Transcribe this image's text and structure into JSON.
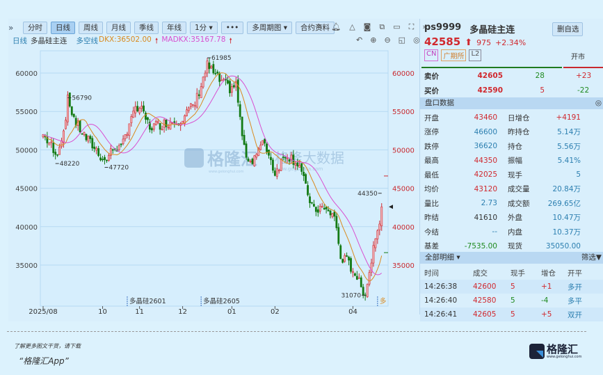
{
  "toolbar": {
    "buttons": [
      "分时",
      "日线",
      "周线",
      "月线",
      "季线",
      "年线",
      "1分 ▾",
      "•••",
      "多周期图 ▾",
      "合约资料"
    ],
    "active": "日线",
    "expand": "»"
  },
  "legend": {
    "period": "日线",
    "name": "多晶硅主连",
    "indicator": "多空线",
    "dkx": "DKX:36502.00",
    "madkx": "MADKX:35167.78",
    "arrow": "🠕"
  },
  "colors": {
    "up": "#d0282e",
    "down": "#137a13",
    "dkx": "#d98a1e",
    "madkx": "#d94fd0",
    "grid": "#b5d9f3"
  },
  "chart_data": {
    "type": "candlestick",
    "ylim": [
      30000,
      63500
    ],
    "yticks": [
      35000,
      40000,
      45000,
      50000,
      55000,
      60000
    ],
    "ytick_labels_left": [
      "35000",
      "40000",
      "45000",
      "50000",
      "55000",
      "60000"
    ],
    "xticks": [
      {
        "day": 0,
        "label": "2025/08"
      },
      {
        "day": 29,
        "label": "10"
      },
      {
        "day": 47,
        "label": "11"
      },
      {
        "day": 68,
        "label": "12"
      },
      {
        "day": 92,
        "label": "01"
      },
      {
        "day": 113,
        "label": "02"
      },
      {
        "day": 151,
        "label": "04"
      }
    ],
    "close_path": [
      [
        0,
        52000
      ],
      [
        4,
        50500
      ],
      [
        6,
        49000
      ],
      [
        10,
        52500
      ],
      [
        12,
        56500
      ],
      [
        16,
        53500
      ],
      [
        21,
        51500
      ],
      [
        26,
        50000
      ],
      [
        30,
        48500
      ],
      [
        35,
        50500
      ],
      [
        38,
        50000
      ],
      [
        43,
        54500
      ],
      [
        47,
        55500
      ],
      [
        52,
        53000
      ],
      [
        60,
        53500
      ],
      [
        67,
        54000
      ],
      [
        74,
        56000
      ],
      [
        80,
        61000
      ],
      [
        86,
        59000
      ],
      [
        91,
        58000
      ],
      [
        94,
        58500
      ],
      [
        96,
        54000
      ],
      [
        98,
        50000
      ],
      [
        101,
        48500
      ],
      [
        108,
        51000
      ],
      [
        113,
        47000
      ],
      [
        118,
        49500
      ],
      [
        121,
        49000
      ],
      [
        125,
        48000
      ],
      [
        128,
        45000
      ],
      [
        132,
        42000
      ],
      [
        135,
        42500
      ],
      [
        138,
        42000
      ],
      [
        142,
        41500
      ],
      [
        143,
        39500
      ],
      [
        145,
        36000
      ],
      [
        148,
        35500
      ],
      [
        152,
        34000
      ],
      [
        155,
        32000
      ],
      [
        157,
        31500
      ],
      [
        159,
        34000
      ],
      [
        162,
        39000
      ],
      [
        163,
        39500
      ],
      [
        165,
        42585
      ]
    ],
    "annotations": [
      {
        "day": 12,
        "price": 56790,
        "label": "56790"
      },
      {
        "day": 6,
        "price": 48220,
        "label": "48220"
      },
      {
        "day": 30,
        "price": 47720,
        "label": "47720"
      },
      {
        "day": 80,
        "price": 61985,
        "label": "61985"
      },
      {
        "day": 157,
        "price": 31070,
        "label": "31070"
      },
      {
        "day": 165,
        "price": 44350,
        "label": "44350"
      }
    ],
    "contract_marks": [
      {
        "day": 41,
        "label": "多晶硅2601"
      },
      {
        "day": 77,
        "label": "多晶硅2605"
      },
      {
        "day": 163,
        "label": "多"
      }
    ],
    "series": [
      {
        "name": "DKX",
        "value": 36502.0
      },
      {
        "name": "MADKX",
        "value": 35167.78
      }
    ]
  },
  "watermark": {
    "brand": "格隆汇",
    "site": "www.gelonghui.com",
    "data": "格隆大数据",
    "data_site": "www.gogudata.com"
  },
  "quote": {
    "code": "ps9999",
    "name": "多晶硅主连",
    "delete_btn": "删自选",
    "price": "42585",
    "change": "975",
    "pct": "+2.34%",
    "tags": [
      "CN",
      "广期所",
      "L2"
    ],
    "status": "开市",
    "ask_label": "卖价",
    "ask": "42605",
    "ask_vol": "28",
    "ask_chg": "+23",
    "bid_label": "买价",
    "bid": "42590",
    "bid_vol": "5",
    "bid_chg": "-22"
  },
  "pankou": {
    "title": "盘口数据",
    "rows": [
      [
        "开盘",
        "43460",
        "red",
        "日增仓",
        "+4191",
        "red"
      ],
      [
        "涨停",
        "46600",
        "blu",
        "昨持仓",
        "5.14万",
        "blu"
      ],
      [
        "跌停",
        "36620",
        "blu",
        "持仓",
        "5.56万",
        "blu"
      ],
      [
        "最高",
        "44350",
        "red",
        "振幅",
        "5.41%",
        "blu"
      ],
      [
        "最低",
        "42025",
        "red",
        "现手",
        "5",
        "blu"
      ],
      [
        "均价",
        "43120",
        "red",
        "成交量",
        "20.84万",
        "blu"
      ],
      [
        "量比",
        "2.73",
        "blu",
        "成交额",
        "269.65亿",
        "blu"
      ],
      [
        "昨结",
        "41610",
        "blk",
        "外盘",
        "10.47万",
        "blu"
      ],
      [
        "今结",
        "--",
        "blu",
        "内盘",
        "10.37万",
        "blu"
      ],
      [
        "基差",
        "-7535.00",
        "grn",
        "现货",
        "35050.00",
        "blu"
      ]
    ]
  },
  "detail": {
    "title": "全部明细 ▾",
    "filter": "筛选",
    "headers": [
      "时间",
      "成交",
      "现手",
      "增仓",
      "开平"
    ],
    "rows": [
      [
        "14:26:38",
        "42600",
        "5",
        "+1",
        "多开"
      ],
      [
        "14:26:40",
        "42580",
        "5",
        "-4",
        "多平"
      ],
      [
        "14:26:41",
        "42605",
        "5",
        "+5",
        "双开"
      ]
    ]
  },
  "footer": {
    "line1": "了解更多图文干货，请下载",
    "line2": "“格隆汇App”",
    "logo_text": "格隆汇",
    "logo_site": "www.gelonghui.com"
  }
}
